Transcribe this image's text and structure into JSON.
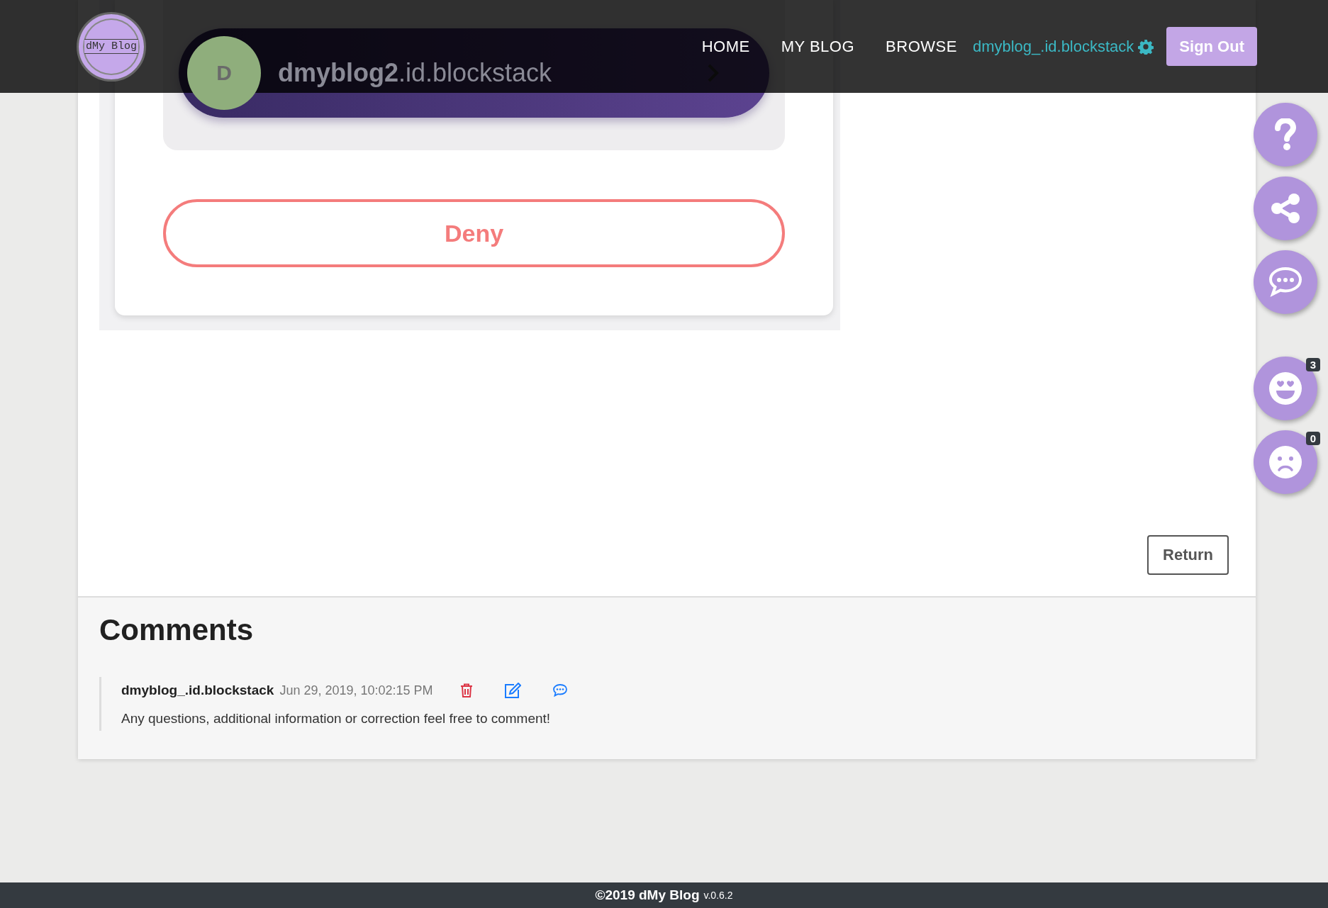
{
  "header": {
    "logo_text": "dMy Blog",
    "nav": [
      {
        "label": "HOME"
      },
      {
        "label": "MY BLOG"
      },
      {
        "label": "BROWSE"
      }
    ],
    "user": "dmyblog_.id.blockstack",
    "sign_out": "Sign Out"
  },
  "embedded_screenshot": {
    "account": {
      "initial": "D",
      "name": "**dmyblog2**.id.blockstack"
    },
    "deny": "Deny"
  },
  "return_button": "Return",
  "comments": {
    "title": "Comments",
    "items": [
      {
        "author": "dmyblog_.id.blockstack",
        "time": "Jun 29, 2019, 10:02:15 PM",
        "text": "Any questions, additional information or correction feel free to comment!"
      }
    ]
  },
  "floating_buttons": [
    {
      "kind": "help"
    },
    {
      "kind": "share"
    },
    {
      "kind": "chat"
    },
    {
      "kind": "love",
      "count": "3"
    },
    {
      "kind": "sad",
      "count": "0"
    }
  ],
  "footer": {
    "copyright": "©2019 dMy Blog",
    "version": "v.0.6.2"
  }
}
